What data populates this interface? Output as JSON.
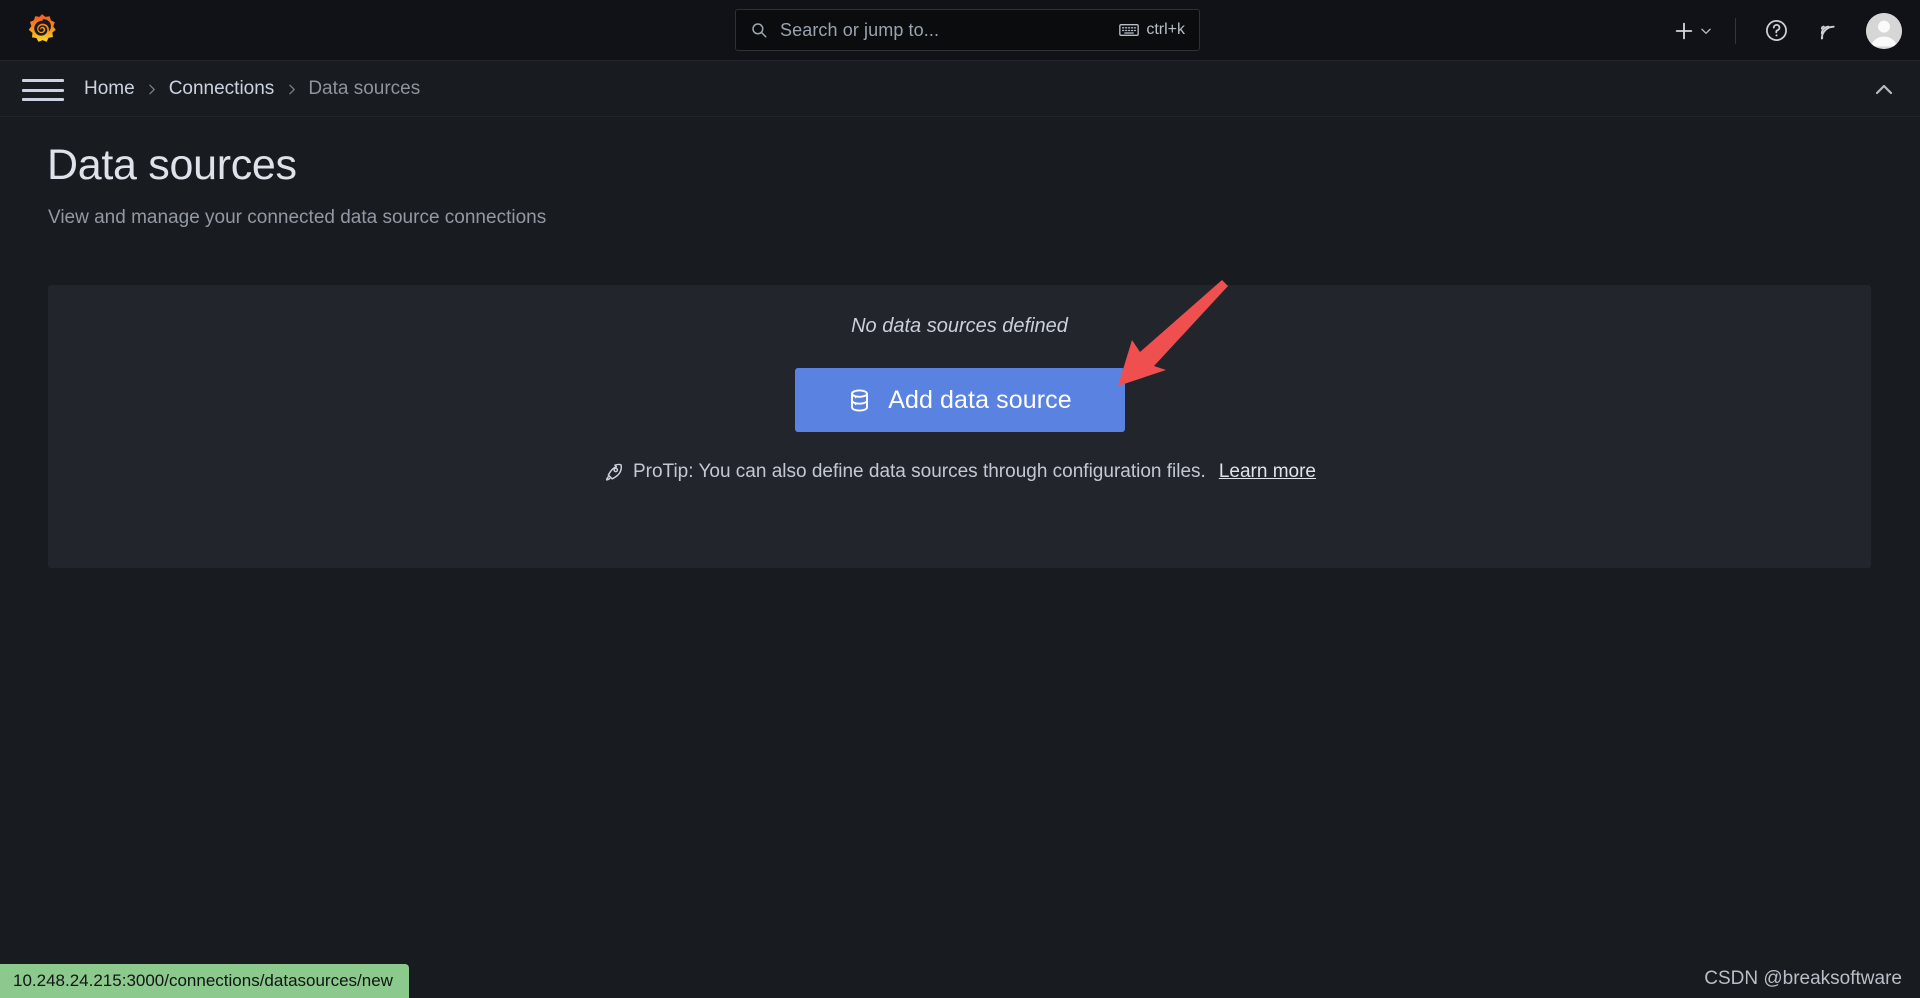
{
  "topbar": {
    "logo_icon": "grafana-logo-icon",
    "search": {
      "placeholder": "Search or jump to...",
      "value": "",
      "icon": "search-icon",
      "shortcut_icon": "keyboard-icon",
      "shortcut": "ctrl+k"
    },
    "actions": {
      "new_icon": "plus-icon",
      "new_chevron_icon": "chevron-down-icon",
      "help_icon": "question-circle-icon",
      "news_icon": "rss-feed-icon",
      "avatar_icon": "user-avatar-icon"
    }
  },
  "breadcrumbbar": {
    "menu_icon": "hamburger-menu-icon",
    "collapse_icon": "chevron-up-icon",
    "separator": "chevron-right-icon",
    "crumbs": [
      {
        "label": "Home",
        "current": false
      },
      {
        "label": "Connections",
        "current": false
      },
      {
        "label": "Data sources",
        "current": true
      }
    ]
  },
  "page": {
    "title": "Data sources",
    "subtitle": "View and manage your connected data source connections"
  },
  "card": {
    "empty_message": "No data sources defined",
    "add_button": {
      "label": "Add data source",
      "icon": "database-icon",
      "color": "#5a82e0"
    },
    "protip": {
      "icon": "rocket-icon",
      "text": "ProTip: You can also define data sources through configuration files.",
      "link_label": "Learn more"
    }
  },
  "annotation": {
    "arrow_color": "#f04f4f",
    "points_to": "add-data-source-button"
  },
  "statusbar": {
    "url": "10.248.24.215:3000/connections/datasources/new",
    "background": "#8cc98c"
  },
  "watermark": {
    "text": "CSDN @breaksoftware"
  }
}
